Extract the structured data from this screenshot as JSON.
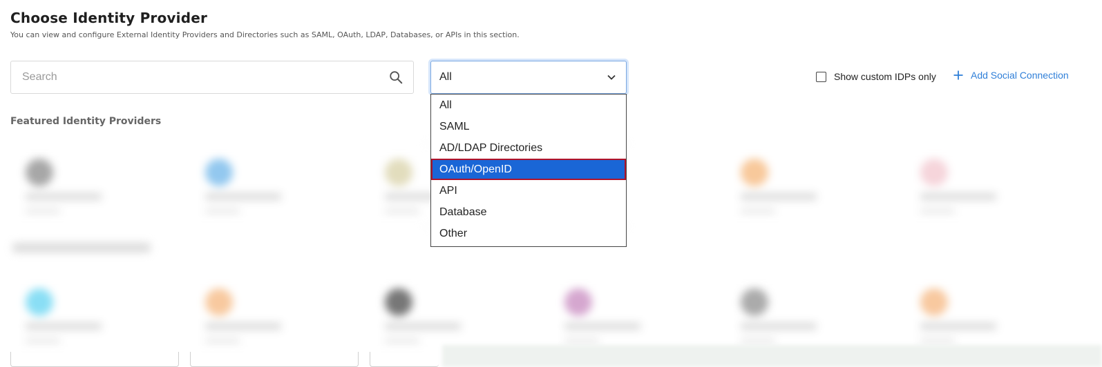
{
  "header": {
    "title": "Choose Identity Provider",
    "subtitle": "You can view and configure External Identity Providers and Directories such as SAML, OAuth, LDAP, Databases, or APIs in this section."
  },
  "search": {
    "placeholder": "Search",
    "value": ""
  },
  "filter": {
    "selected": "All",
    "options": [
      "All",
      "SAML",
      "AD/LDAP Directories",
      "OAuth/OpenID",
      "API",
      "Database",
      "Other"
    ],
    "highlighted": "OAuth/OpenID"
  },
  "toolbar": {
    "custom_idps_label": "Show custom IDPs only",
    "add_social_label": "Add Social Connection"
  },
  "sections": {
    "featured_label": "Featured Identity Providers"
  },
  "colors": {
    "accent": "#2f7fd8",
    "selected_option_bg": "#1a66d6",
    "selected_option_outline": "#b0132a"
  },
  "icons": {
    "search": "search-icon",
    "chevron": "chevron-down-icon",
    "plus": "plus-icon",
    "checkbox": "checkbox-icon"
  }
}
